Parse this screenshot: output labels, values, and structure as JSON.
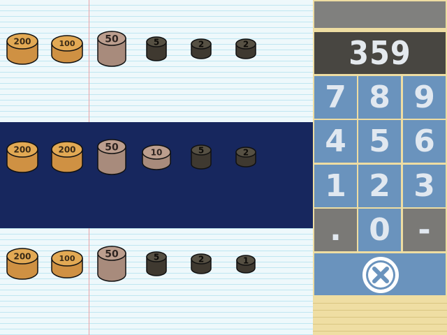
{
  "board": {
    "rows": [
      {
        "selected": false,
        "coins": [
          "200",
          "100",
          "50",
          "5",
          "2",
          "2"
        ]
      },
      {
        "selected": true,
        "coins": [
          "200",
          "200",
          "50",
          "10",
          "5",
          "2"
        ]
      },
      {
        "selected": false,
        "coins": [
          "200",
          "100",
          "50",
          "5",
          "2",
          "1"
        ]
      }
    ]
  },
  "coin_styles": {
    "200": {
      "body": "#cf9143",
      "top": "#e2a954",
      "text": "#3a2a16"
    },
    "100": {
      "body": "#cf9143",
      "top": "#e2a954",
      "text": "#3a2a16"
    },
    "50": {
      "body": "#a88b7c",
      "top": "#bc9e8e",
      "text": "#2e2420"
    },
    "10": {
      "body": "#a88b7c",
      "top": "#bc9e8e",
      "text": "#2e2420"
    },
    "5": {
      "body": "#3f3930",
      "top": "#565043",
      "text": "#0d0b08"
    },
    "2": {
      "body": "#3f3930",
      "top": "#565043",
      "text": "#0d0b08"
    },
    "1": {
      "body": "#3f3930",
      "top": "#565043",
      "text": "#0d0b08"
    }
  },
  "keypad": {
    "display_value": "359",
    "keys": [
      "7",
      "8",
      "9",
      "4",
      "5",
      "6",
      "1",
      "2",
      "3",
      ".",
      "0",
      "-"
    ],
    "clear_icon": "x-circle-icon"
  },
  "colors": {
    "paper": "#eef8fb",
    "ruled_line": "#bfe6f1",
    "margin_line": "#e7a2a7",
    "selected_row": "#17275e",
    "key_blue": "#6a93bd",
    "key_gray": "#7a7976",
    "display_bg": "#484641",
    "keypad_bg": "#eedda2"
  }
}
